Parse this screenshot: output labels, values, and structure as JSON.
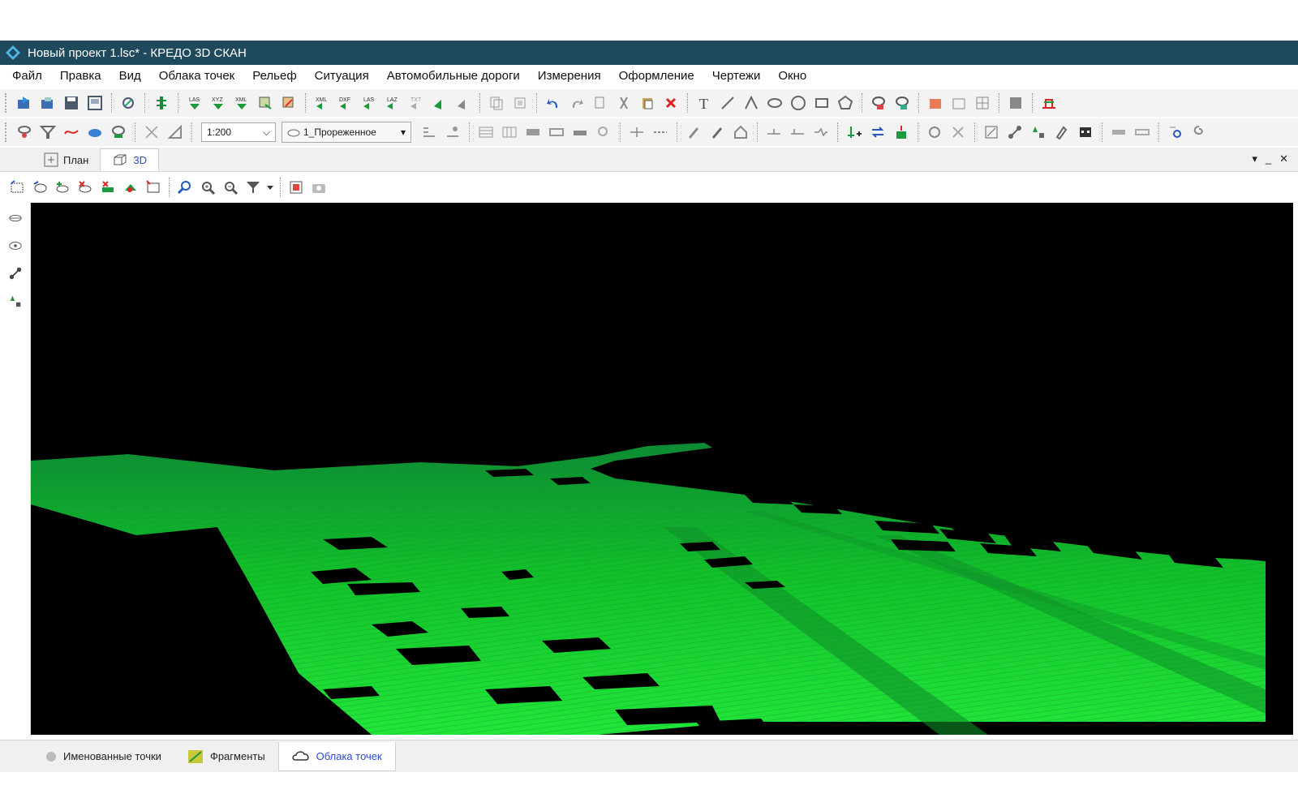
{
  "window": {
    "title": "Новый проект 1.lsc* - КРЕДО 3D СКАН",
    "app_icon": "credo-diamond-icon"
  },
  "menu": [
    "Файл",
    "Правка",
    "Вид",
    "Облака точек",
    "Рельеф",
    "Ситуация",
    "Автомобильные дороги",
    "Измерения",
    "Оформление",
    "Чертежи",
    "Окно"
  ],
  "toolbar1": {
    "labels": {
      "las": "LAS",
      "xyz": "XYZ",
      "xml": "XML",
      "xml2": "XML",
      "dxf": "DXF",
      "las2": "LAS",
      "laz": "LAZ",
      "txt": "TXT",
      "text_tool": "T"
    }
  },
  "toolbar2": {
    "scale": "1:200",
    "layer": "1_Прореженное"
  },
  "view_tabs": [
    {
      "label": "План"
    },
    {
      "label": "3D"
    }
  ],
  "bottom_tabs": [
    {
      "label": "Именованные точки"
    },
    {
      "label": "Фрагменты"
    },
    {
      "label": "Облака точек"
    }
  ],
  "colors": {
    "titlebar": "#1f4a5e",
    "accent_tab": "#2a4ccc",
    "cloud_green": "#19d52a",
    "viewport_bg": "#000000"
  }
}
